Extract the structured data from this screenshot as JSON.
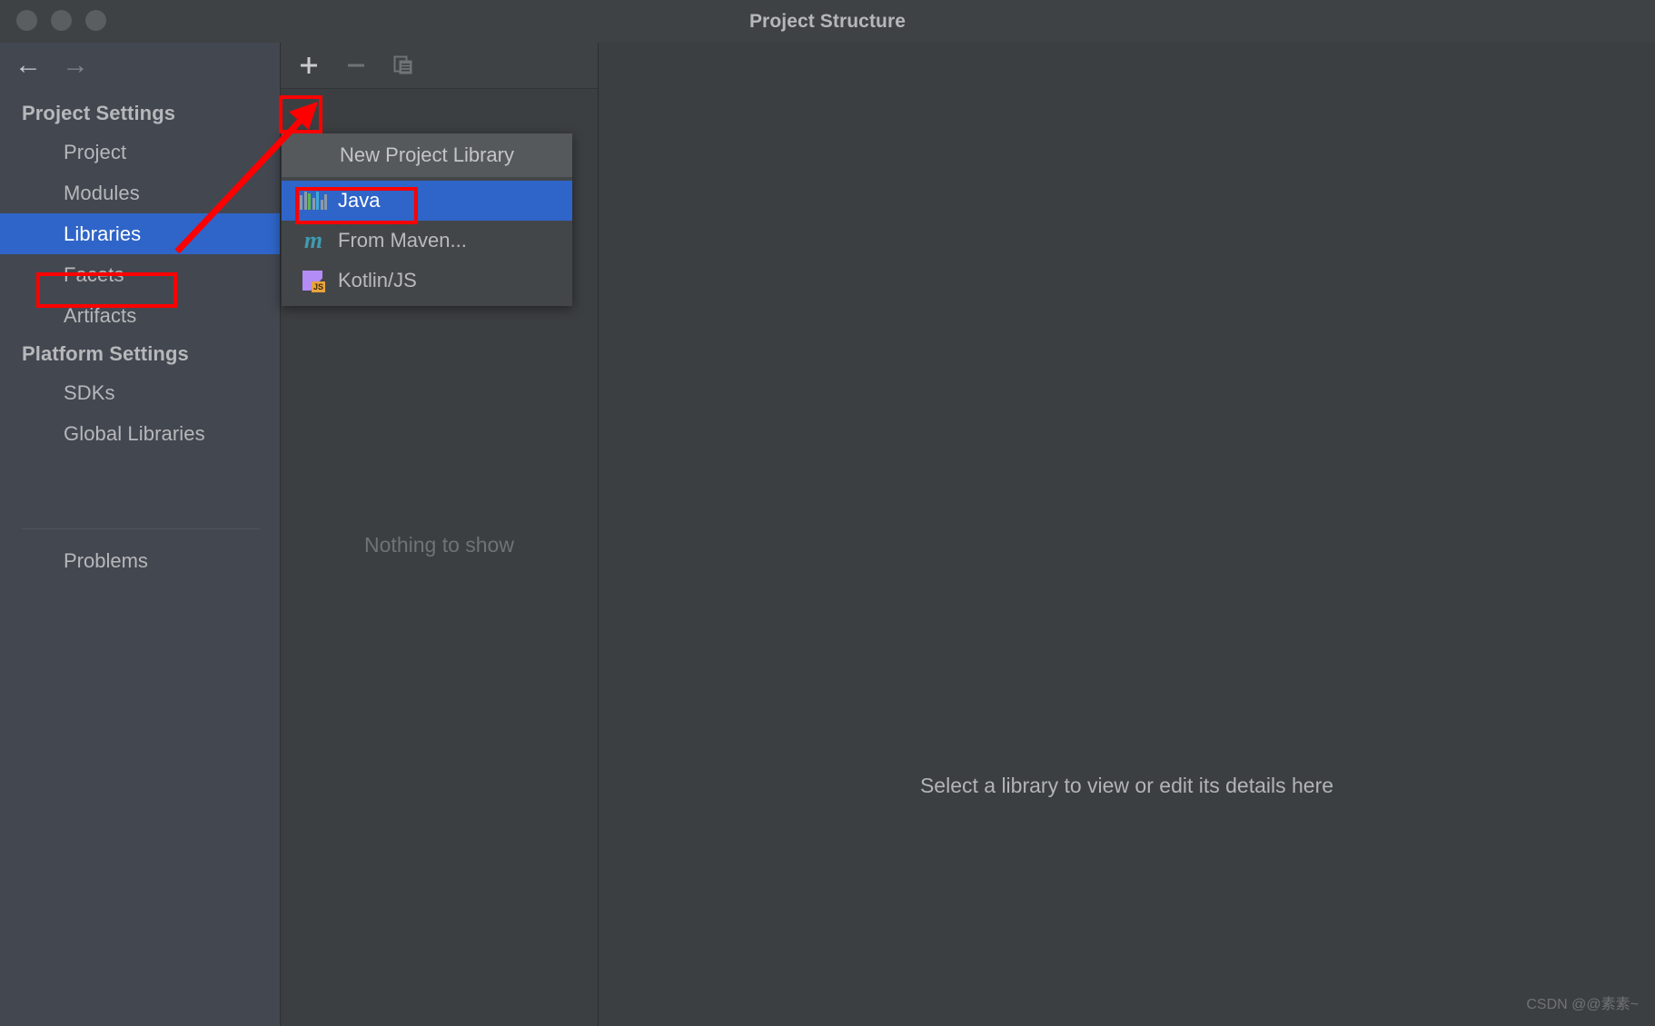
{
  "window": {
    "title": "Project Structure",
    "traffic_lights": [
      "close",
      "minimize",
      "maximize"
    ]
  },
  "navigation": {
    "back_icon": "arrow-left-icon",
    "forward_icon": "arrow-right-icon",
    "back_glyph": "←",
    "forward_glyph": "→"
  },
  "sidebar": {
    "groups": [
      {
        "label": "Project Settings",
        "items": [
          {
            "label": "Project",
            "selected": false
          },
          {
            "label": "Modules",
            "selected": false
          },
          {
            "label": "Libraries",
            "selected": true
          },
          {
            "label": "Facets",
            "selected": false
          },
          {
            "label": "Artifacts",
            "selected": false
          }
        ]
      },
      {
        "label": "Platform Settings",
        "items": [
          {
            "label": "SDKs",
            "selected": false
          },
          {
            "label": "Global Libraries",
            "selected": false
          }
        ]
      }
    ],
    "footer_item": {
      "label": "Problems"
    }
  },
  "toolbar": {
    "add_label": "+",
    "add_icon": "plus-icon",
    "remove_label": "−",
    "remove_icon": "minus-icon",
    "copy_icon": "copy-icon"
  },
  "middle_panel": {
    "empty_message": "Nothing to show"
  },
  "detail_panel": {
    "message": "Select a library to view or edit its details here"
  },
  "popup_menu": {
    "header": "New Project Library",
    "items": [
      {
        "label": "Java",
        "icon": "java-icon",
        "highlighted": true
      },
      {
        "label": "From Maven...",
        "icon": "maven-icon",
        "highlighted": false
      },
      {
        "label": "Kotlin/JS",
        "icon": "kotlin-js-icon",
        "highlighted": false
      }
    ]
  },
  "annotations": {
    "highlight_color": "#ff0000",
    "boxes": [
      "add-button",
      "libraries-sidebar-item",
      "java-menu-item"
    ],
    "arrow": "arrow-from-modules-to-add-button"
  },
  "watermark": {
    "text": "CSDN @@素素~"
  },
  "colors": {
    "accent_selection": "#2f65c8",
    "window_bg": "#3c3f41",
    "sidebar_bg": "#434750",
    "annotation": "#ff0000"
  }
}
